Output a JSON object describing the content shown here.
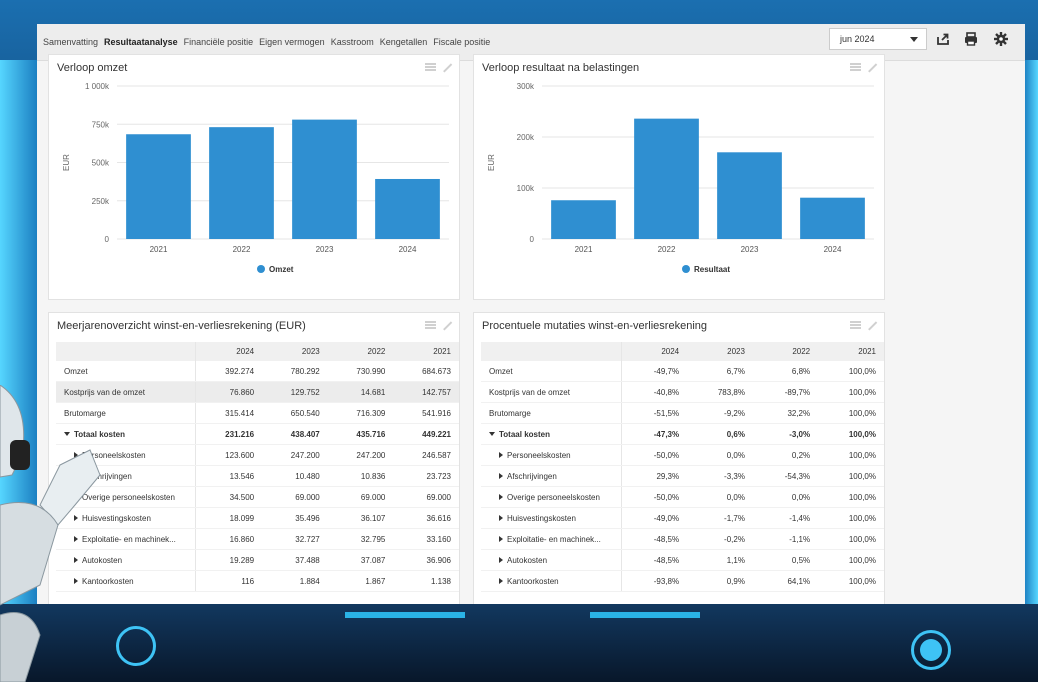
{
  "tabs": [
    {
      "label": "Samenvatting",
      "active": false
    },
    {
      "label": "Resultaatanalyse",
      "active": true
    },
    {
      "label": "Financiële positie",
      "active": false
    },
    {
      "label": "Eigen vermogen",
      "active": false
    },
    {
      "label": "Kasstroom",
      "active": false
    },
    {
      "label": "Kengetallen",
      "active": false
    },
    {
      "label": "Fiscale positie",
      "active": false
    }
  ],
  "period": {
    "selected": "jun 2024"
  },
  "toolbar_icons": [
    "export-icon",
    "print-icon",
    "gear-icon"
  ],
  "colors": {
    "accent": "#2f6fa8",
    "bar": "#2f8fd1",
    "frame": "#3ec3f5"
  },
  "charts": [
    {
      "title": "Verloop omzet",
      "chart_data": {
        "type": "bar",
        "categories": [
          "2021",
          "2022",
          "2023",
          "2024"
        ],
        "series": [
          {
            "name": "Omzet",
            "values": [
              684673,
              730990,
              780292,
              392274
            ]
          }
        ],
        "ylabel": "EUR",
        "yticks": [
          "0",
          "250k",
          "500k",
          "750k",
          "1 000k"
        ],
        "ylim": [
          0,
          1000000
        ],
        "grid": true,
        "legend": "bottom"
      }
    },
    {
      "title": "Verloop resultaat na belastingen",
      "chart_data": {
        "type": "bar",
        "categories": [
          "2021",
          "2022",
          "2023",
          "2024"
        ],
        "series": [
          {
            "name": "Resultaat",
            "values": [
              76000,
              236000,
              170000,
              81000
            ]
          }
        ],
        "ylabel": "EUR",
        "yticks": [
          "0",
          "100k",
          "200k",
          "300k"
        ],
        "ylim": [
          0,
          300000
        ],
        "grid": true,
        "legend": "bottom"
      }
    }
  ],
  "table_abs": {
    "title": "Meerjarenoverzicht winst-en-verliesrekening (EUR)",
    "headers": [
      "",
      "2024",
      "2023",
      "2022",
      "2021"
    ],
    "rows": [
      {
        "label": "Omzet",
        "values": [
          "392.274",
          "780.292",
          "730.990",
          "684.673"
        ]
      },
      {
        "label": "Kostprijs van de omzet",
        "values": [
          "76.860",
          "129.752",
          "14.681",
          "142.757"
        ]
      },
      {
        "label": "Brutomarge",
        "values": [
          "315.414",
          "650.540",
          "716.309",
          "541.916"
        ]
      },
      {
        "label": "Totaal kosten",
        "values": [
          "231.216",
          "438.407",
          "435.716",
          "449.221"
        ]
      },
      {
        "label": "Personeelskosten",
        "values": [
          "123.600",
          "247.200",
          "247.200",
          "246.587"
        ]
      },
      {
        "label": "Afschrijvingen",
        "values": [
          "13.546",
          "10.480",
          "10.836",
          "23.723"
        ]
      },
      {
        "label": "Overige personeelskosten",
        "values": [
          "34.500",
          "69.000",
          "69.000",
          "69.000"
        ]
      },
      {
        "label": "Huisvestingskosten",
        "values": [
          "18.099",
          "35.496",
          "36.107",
          "36.616"
        ]
      },
      {
        "label": "Exploitatie- en machinek...",
        "values": [
          "16.860",
          "32.727",
          "32.795",
          "33.160"
        ]
      },
      {
        "label": "Autokosten",
        "values": [
          "19.289",
          "37.488",
          "37.087",
          "36.906"
        ]
      },
      {
        "label": "Kantoorkosten",
        "values": [
          "116",
          "1.884",
          "1.867",
          "1.138"
        ]
      }
    ]
  },
  "table_pct": {
    "title": "Procentuele mutaties winst-en-verliesrekening",
    "headers": [
      "",
      "2024",
      "2023",
      "2022",
      "2021"
    ],
    "rows": [
      {
        "label": "Omzet",
        "values": [
          "-49,7%",
          "6,7%",
          "6,8%",
          "100,0%"
        ]
      },
      {
        "label": "Kostprijs van de omzet",
        "values": [
          "-40,8%",
          "783,8%",
          "-89,7%",
          "100,0%"
        ]
      },
      {
        "label": "Brutomarge",
        "values": [
          "-51,5%",
          "-9,2%",
          "32,2%",
          "100,0%"
        ]
      },
      {
        "label": "Totaal kosten",
        "values": [
          "-47,3%",
          "0,6%",
          "-3,0%",
          "100,0%"
        ]
      },
      {
        "label": "Personeelskosten",
        "values": [
          "-50,0%",
          "0,0%",
          "0,2%",
          "100,0%"
        ]
      },
      {
        "label": "Afschrijvingen",
        "values": [
          "29,3%",
          "-3,3%",
          "-54,3%",
          "100,0%"
        ]
      },
      {
        "label": "Overige personeelskosten",
        "values": [
          "-50,0%",
          "0,0%",
          "0,0%",
          "100,0%"
        ]
      },
      {
        "label": "Huisvestingskosten",
        "values": [
          "-49,0%",
          "-1,7%",
          "-1,4%",
          "100,0%"
        ]
      },
      {
        "label": "Exploitatie- en machinek...",
        "values": [
          "-48,5%",
          "-0,2%",
          "-1,1%",
          "100,0%"
        ]
      },
      {
        "label": "Autokosten",
        "values": [
          "-48,5%",
          "1,1%",
          "0,5%",
          "100,0%"
        ]
      },
      {
        "label": "Kantoorkosten",
        "values": [
          "-93,8%",
          "0,9%",
          "64,1%",
          "100,0%"
        ]
      }
    ]
  }
}
